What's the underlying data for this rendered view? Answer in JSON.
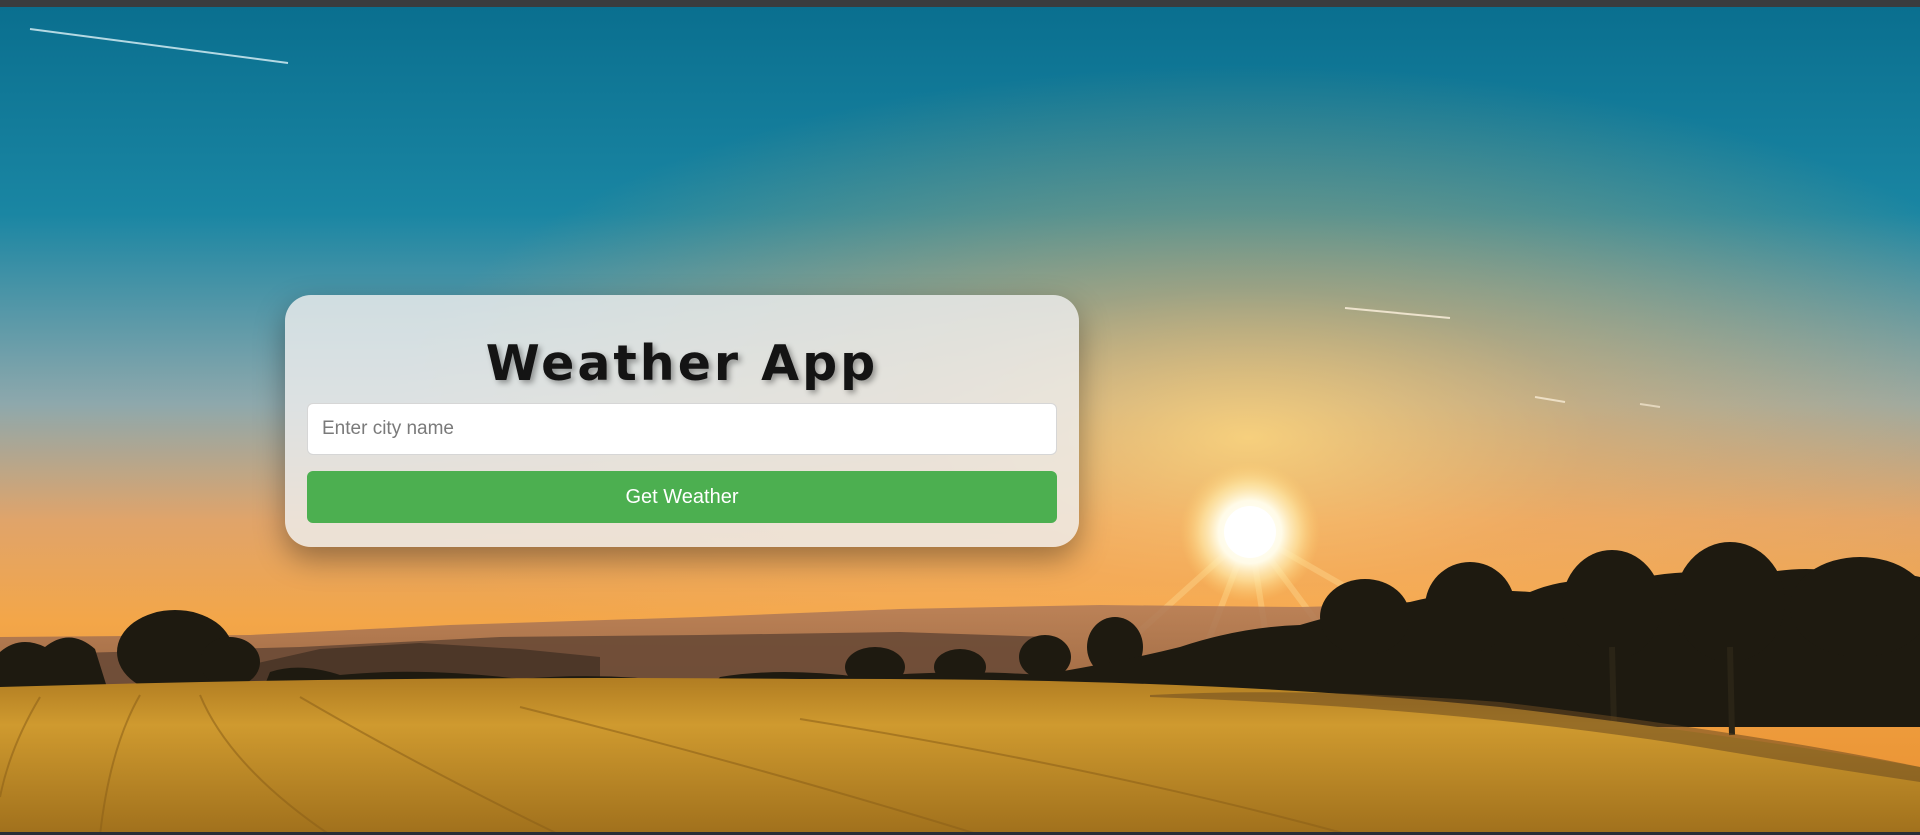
{
  "app": {
    "title": "Weather App"
  },
  "search": {
    "placeholder": "Enter city name",
    "value": ""
  },
  "actions": {
    "get_weather_label": "Get Weather"
  },
  "theme": {
    "button_color": "#4caf50",
    "card_color": "#eeeeee",
    "sky_top": "#0f7a99",
    "sky_horizon": "#f0a04a",
    "field_color": "#c9962a"
  },
  "background": {
    "icon": "sunset-landscape-image"
  }
}
